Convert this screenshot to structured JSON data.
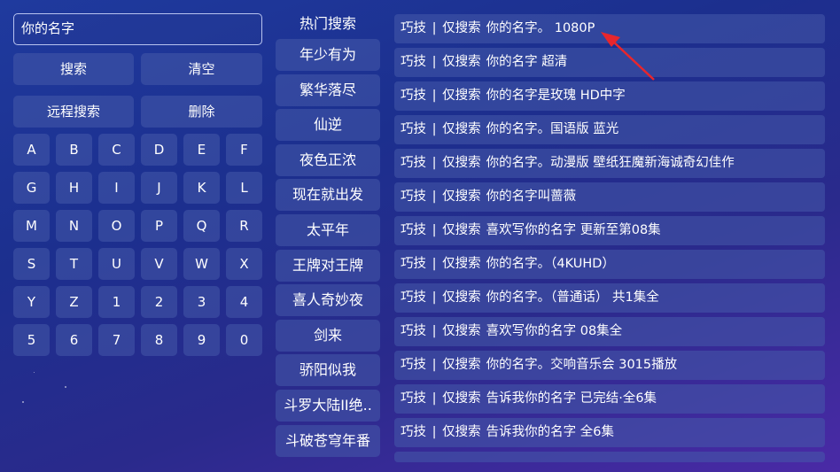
{
  "search": {
    "value": "你的名字"
  },
  "actions": {
    "search_label": "搜索",
    "clear_label": "清空",
    "remote_search_label": "远程搜索",
    "delete_label": "删除"
  },
  "keyboard": {
    "keys": [
      "A",
      "B",
      "C",
      "D",
      "E",
      "F",
      "G",
      "H",
      "I",
      "J",
      "K",
      "L",
      "M",
      "N",
      "O",
      "P",
      "Q",
      "R",
      "S",
      "T",
      "U",
      "V",
      "W",
      "X",
      "Y",
      "Z",
      "1",
      "2",
      "3",
      "4",
      "5",
      "6",
      "7",
      "8",
      "9",
      "0"
    ]
  },
  "hot": {
    "title": "热门搜索",
    "items": [
      "年少有为",
      "繁华落尽",
      "仙逆",
      "夜色正浓",
      "现在就出发",
      "太平年",
      "王牌对王牌",
      "喜人奇妙夜",
      "剑来",
      "骄阳似我",
      "斗罗大陆II绝..",
      "斗破苍穹年番"
    ]
  },
  "results": [
    {
      "source": "巧技",
      "sep": "|",
      "mode": "仅搜索",
      "title": "你的名字。 1080P"
    },
    {
      "source": "巧技",
      "sep": "|",
      "mode": "仅搜索",
      "title": "你的名字 超清"
    },
    {
      "source": "巧技",
      "sep": "|",
      "mode": "仅搜索",
      "title": "你的名字是玫瑰 HD中字"
    },
    {
      "source": "巧技",
      "sep": "|",
      "mode": "仅搜索",
      "title": "你的名字。国语版 蓝光"
    },
    {
      "source": "巧技",
      "sep": "|",
      "mode": "仅搜索",
      "title": "你的名字。动漫版 壁纸狂魔新海诚奇幻佳作"
    },
    {
      "source": "巧技",
      "sep": "|",
      "mode": "仅搜索",
      "title": "你的名字叫蔷薇"
    },
    {
      "source": "巧技",
      "sep": "|",
      "mode": "仅搜索",
      "title": "喜欢写你的名字 更新至第08集"
    },
    {
      "source": "巧技",
      "sep": "|",
      "mode": "仅搜索",
      "title": "你的名字。（4KUHD）"
    },
    {
      "source": "巧技",
      "sep": "|",
      "mode": "仅搜索",
      "title": "你的名字。（普通话） 共1集全"
    },
    {
      "source": "巧技",
      "sep": "|",
      "mode": "仅搜索",
      "title": "喜欢写你的名字 08集全"
    },
    {
      "source": "巧技",
      "sep": "|",
      "mode": "仅搜索",
      "title": "你的名字。交响音乐会 3015播放"
    },
    {
      "source": "巧技",
      "sep": "|",
      "mode": "仅搜索",
      "title": "告诉我你的名字 已完结·全6集"
    },
    {
      "source": "巧技",
      "sep": "|",
      "mode": "仅搜索",
      "title": "告诉我你的名字 全6集"
    }
  ],
  "colors": {
    "arrow": "#e8262c",
    "panel": "#4a5aaa"
  }
}
